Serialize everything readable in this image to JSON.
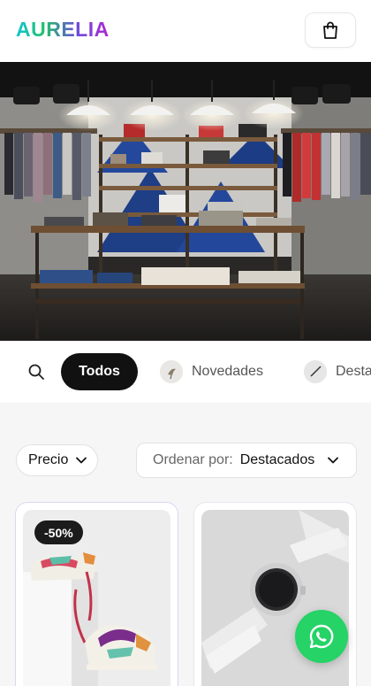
{
  "header": {
    "brand": "AURELIA",
    "cart_icon": "shopping-bag-icon"
  },
  "hero": {
    "image": "clothing-store-interior-photo"
  },
  "categories": {
    "search_icon": "search-icon",
    "items": [
      {
        "label": "Todos",
        "active": true
      },
      {
        "label": "Novedades",
        "active": false,
        "thumb": "bird-thumbnail"
      },
      {
        "label": "Destacados",
        "active": false,
        "thumb": "feather-thumbnail"
      }
    ]
  },
  "filters": {
    "price_label": "Precio",
    "sort_label": "Ordenar por:",
    "sort_value": "Destacados"
  },
  "products": [
    {
      "badge": "-50%",
      "image": "sneakers-photo"
    },
    {
      "badge": "",
      "image": "smartwatch-photo"
    }
  ],
  "colors": {
    "accent_dark": "#111111",
    "whatsapp": "#25d366",
    "brand_gradient": [
      "#12c3d6",
      "#20c36a",
      "#6a4bd9",
      "#b128d6"
    ]
  }
}
